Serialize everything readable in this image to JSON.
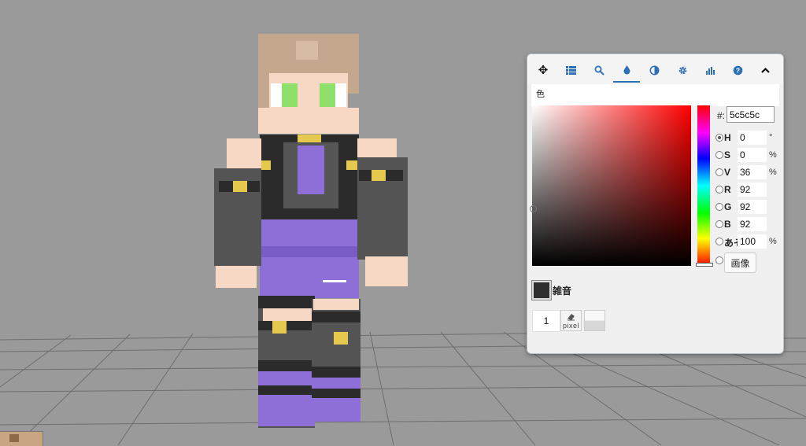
{
  "toolbar": {
    "tabs": [
      {
        "name": "move-icon",
        "glyph": "✥",
        "active": false
      },
      {
        "name": "list-icon",
        "glyph": "",
        "active": false
      },
      {
        "name": "search-icon",
        "glyph": "",
        "active": false
      },
      {
        "name": "droplet-icon",
        "glyph": "",
        "active": true
      },
      {
        "name": "contrast-icon",
        "glyph": "",
        "active": false
      },
      {
        "name": "gear-icon",
        "glyph": "",
        "active": false
      },
      {
        "name": "bars-icon",
        "glyph": "",
        "active": false
      },
      {
        "name": "help-icon",
        "glyph": "",
        "active": false
      },
      {
        "name": "collapse-icon",
        "glyph": "",
        "active": false
      }
    ]
  },
  "color_panel": {
    "title": "色",
    "hex_label": "#:",
    "hex_value": "5c5c5c",
    "accent": "#2d6fb5",
    "rows": [
      {
        "label": "H",
        "value": "0",
        "unit": "°",
        "selected": true
      },
      {
        "label": "S",
        "value": "0",
        "unit": "%",
        "selected": false
      },
      {
        "label": "V",
        "value": "36",
        "unit": "%",
        "selected": false
      },
      {
        "label": "R",
        "value": "92",
        "unit": "",
        "selected": false
      },
      {
        "label": "G",
        "value": "92",
        "unit": "",
        "selected": false
      },
      {
        "label": "B",
        "value": "92",
        "unit": "",
        "selected": false
      },
      {
        "label": "あそ",
        "value": "100",
        "unit": "%",
        "selected": false
      }
    ],
    "image_button": "画像",
    "noise_label": "雑音",
    "brush_size": "1",
    "pixel_tool_label": "pixel"
  }
}
